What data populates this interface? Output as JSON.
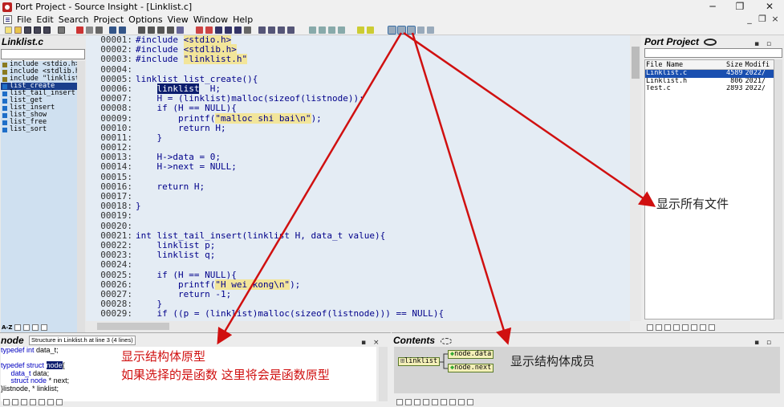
{
  "window": {
    "title": "Port Project - Source Insight - [Linklist.c]",
    "minimize_glyph": "─",
    "restore_glyph": "❐",
    "close_glyph": "✕",
    "mdi_minimize_glyph": "_",
    "mdi_restore_glyph": "❐",
    "mdi_close_glyph": "×"
  },
  "menu": [
    "File",
    "Edit",
    "Search",
    "Project",
    "Options",
    "View",
    "Window",
    "Help"
  ],
  "symbol_window": {
    "title": "Linklist.c",
    "items": [
      {
        "label": "include <stdio.h>",
        "kind": "include",
        "selected": false
      },
      {
        "label": "include <stdlib.h>",
        "kind": "include",
        "selected": false
      },
      {
        "label": "include \"linklist.",
        "kind": "include",
        "selected": false
      },
      {
        "label": "list_create",
        "kind": "function",
        "selected": true
      },
      {
        "label": "list_tail_insert",
        "kind": "function",
        "selected": false
      },
      {
        "label": "list_get",
        "kind": "function",
        "selected": false
      },
      {
        "label": "list_insert",
        "kind": "function",
        "selected": false
      },
      {
        "label": "list_show",
        "kind": "function",
        "selected": false
      },
      {
        "label": "list_free",
        "kind": "function",
        "selected": false
      },
      {
        "label": "list_sort",
        "kind": "function",
        "selected": false
      }
    ],
    "footer_label": "A-Z"
  },
  "editor": {
    "lines": [
      {
        "num": "00001:",
        "segments": [
          {
            "t": "#include "
          },
          {
            "t": "<stdio.h>",
            "hl": true
          }
        ]
      },
      {
        "num": "00002:",
        "segments": [
          {
            "t": "#include "
          },
          {
            "t": "<stdlib.h>",
            "hl": true
          }
        ]
      },
      {
        "num": "00003:",
        "segments": [
          {
            "t": "#include "
          },
          {
            "t": "\"linklist.h\"",
            "hl": true
          }
        ]
      },
      {
        "num": "00004:",
        "segments": []
      },
      {
        "num": "00005:",
        "segments": [
          {
            "t": "linklist list_create(){"
          }
        ]
      },
      {
        "num": "00006:",
        "segments": [
          {
            "t": "    "
          },
          {
            "t": "linklist",
            "sel": true
          },
          {
            "t": "  H;"
          }
        ]
      },
      {
        "num": "00007:",
        "segments": [
          {
            "t": "    H = (linklist)malloc(sizeof(listnode));"
          }
        ]
      },
      {
        "num": "00008:",
        "segments": [
          {
            "t": "    if (H == NULL){"
          }
        ]
      },
      {
        "num": "00009:",
        "segments": [
          {
            "t": "        printf("
          },
          {
            "t": "\"malloc shi bai\\n\"",
            "hl": true
          },
          {
            "t": ");"
          }
        ]
      },
      {
        "num": "00010:",
        "segments": [
          {
            "t": "        return H;"
          }
        ]
      },
      {
        "num": "00011:",
        "segments": [
          {
            "t": "    }"
          }
        ]
      },
      {
        "num": "00012:",
        "segments": []
      },
      {
        "num": "00013:",
        "segments": [
          {
            "t": "    H->data = 0;"
          }
        ]
      },
      {
        "num": "00014:",
        "segments": [
          {
            "t": "    H->next = NULL;"
          }
        ]
      },
      {
        "num": "00015:",
        "segments": []
      },
      {
        "num": "00016:",
        "segments": [
          {
            "t": "    return H;"
          }
        ]
      },
      {
        "num": "00017:",
        "segments": []
      },
      {
        "num": "00018:",
        "segments": [
          {
            "t": "}"
          }
        ]
      },
      {
        "num": "00019:",
        "segments": []
      },
      {
        "num": "00020:",
        "segments": []
      },
      {
        "num": "00021:",
        "segments": [
          {
            "t": "int list_tail_insert(linklist H, data_t value){"
          }
        ]
      },
      {
        "num": "00022:",
        "segments": [
          {
            "t": "    linklist p;"
          }
        ]
      },
      {
        "num": "00023:",
        "segments": [
          {
            "t": "    linklist q;"
          }
        ]
      },
      {
        "num": "00024:",
        "segments": []
      },
      {
        "num": "00025:",
        "segments": [
          {
            "t": "    if (H == NULL){"
          }
        ]
      },
      {
        "num": "00026:",
        "segments": [
          {
            "t": "        printf("
          },
          {
            "t": "\"H wei kong\\n\"",
            "hl": true
          },
          {
            "t": ");"
          }
        ]
      },
      {
        "num": "00027:",
        "segments": [
          {
            "t": "        return -1;"
          }
        ]
      },
      {
        "num": "00028:",
        "segments": [
          {
            "t": "    }"
          }
        ]
      },
      {
        "num": "00029:",
        "segments": [
          {
            "t": "    if ((p = (linklist)malloc(sizeof(listnode))) == NULL){"
          }
        ]
      }
    ]
  },
  "project_window": {
    "title": "Port Project",
    "columns": [
      "File Name",
      "Size",
      "Modifi"
    ],
    "files": [
      {
        "name": "Linklist.c",
        "size": "4589",
        "modified": "2022/",
        "selected": true
      },
      {
        "name": "Linklist.h",
        "size": "806",
        "modified": "2021/",
        "selected": false
      },
      {
        "name": "Test.c",
        "size": "2893",
        "modified": "2022/",
        "selected": false
      }
    ]
  },
  "context_window": {
    "title": "node",
    "tag": "Structure in Linklist.h at line 3 (4 lines)",
    "lines": [
      [
        {
          "t": "typedef ",
          "k": true
        },
        {
          "t": "int",
          "k": true
        },
        {
          "t": " data_t;"
        }
      ],
      [],
      [
        {
          "t": "typedef ",
          "k": true
        },
        {
          "t": "struct ",
          "k": true
        },
        {
          "t": "node",
          "sel": true
        },
        {
          "t": "{"
        }
      ],
      [
        {
          "t": "     "
        },
        {
          "t": "data_t",
          "k": true
        },
        {
          "t": " data;"
        }
      ],
      [
        {
          "t": "     "
        },
        {
          "t": "struct ",
          "k": true
        },
        {
          "t": "node",
          "k": true
        },
        {
          "t": " * next;"
        }
      ],
      [
        {
          "t": "}listnode, * linklist;"
        }
      ]
    ]
  },
  "relation_window": {
    "title": "Contents",
    "root": "linklist",
    "children": [
      "node.data",
      "node.next"
    ]
  },
  "annotations": {
    "show_all_files": "显示所有文件",
    "struct_prototype": "显示结构体原型",
    "function_prototype": "如果选择的是函数 这里将会是函数原型",
    "struct_members": "显示结构体成员"
  },
  "colors": {
    "annotation": "#d01010",
    "selection": "#0b1d6e",
    "string_highlight": "#f2e59a",
    "code_text": "#00008a",
    "editor_bg": "#e4ecf4"
  }
}
